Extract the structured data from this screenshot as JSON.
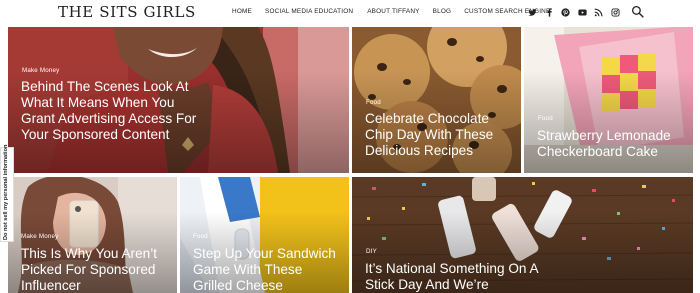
{
  "site": {
    "logo": "THE SITS GIRLS"
  },
  "nav": {
    "items": [
      {
        "label": "HOME"
      },
      {
        "label": "SOCIAL MEDIA EDUCATION"
      },
      {
        "label": "ABOUT TIFFANY"
      },
      {
        "label": "BLOG"
      },
      {
        "label": "CUSTOM SEARCH ENGINE"
      }
    ]
  },
  "social": [
    "twitter-icon",
    "facebook-icon",
    "pinterest-icon",
    "youtube-icon",
    "rss-icon",
    "instagram-icon"
  ],
  "posts": [
    {
      "category": "Make Money",
      "title": "Behind The Scenes Look At What It Means When You Grant Advertising Access For Your Sponsored Content"
    },
    {
      "category": "Food",
      "title": "Celebrate Chocolate Chip Day With These Delicious Recipes"
    },
    {
      "category": "Food",
      "title": "Strawberry Lemonade Checkerboard Cake"
    },
    {
      "category": "Make Money",
      "title": "This Is Why You Aren’t Picked For Sponsored Influencer"
    },
    {
      "category": "Food",
      "title": "Step Up Your Sandwich Game With These Grilled Cheese"
    },
    {
      "category": "DIY",
      "title": "It’s National Something On A Stick Day And We’re"
    }
  ],
  "privacy_tab": {
    "label": "Do not sell my personal information"
  },
  "colors": {
    "text": "#222222",
    "tile_text": "#ffffff"
  }
}
